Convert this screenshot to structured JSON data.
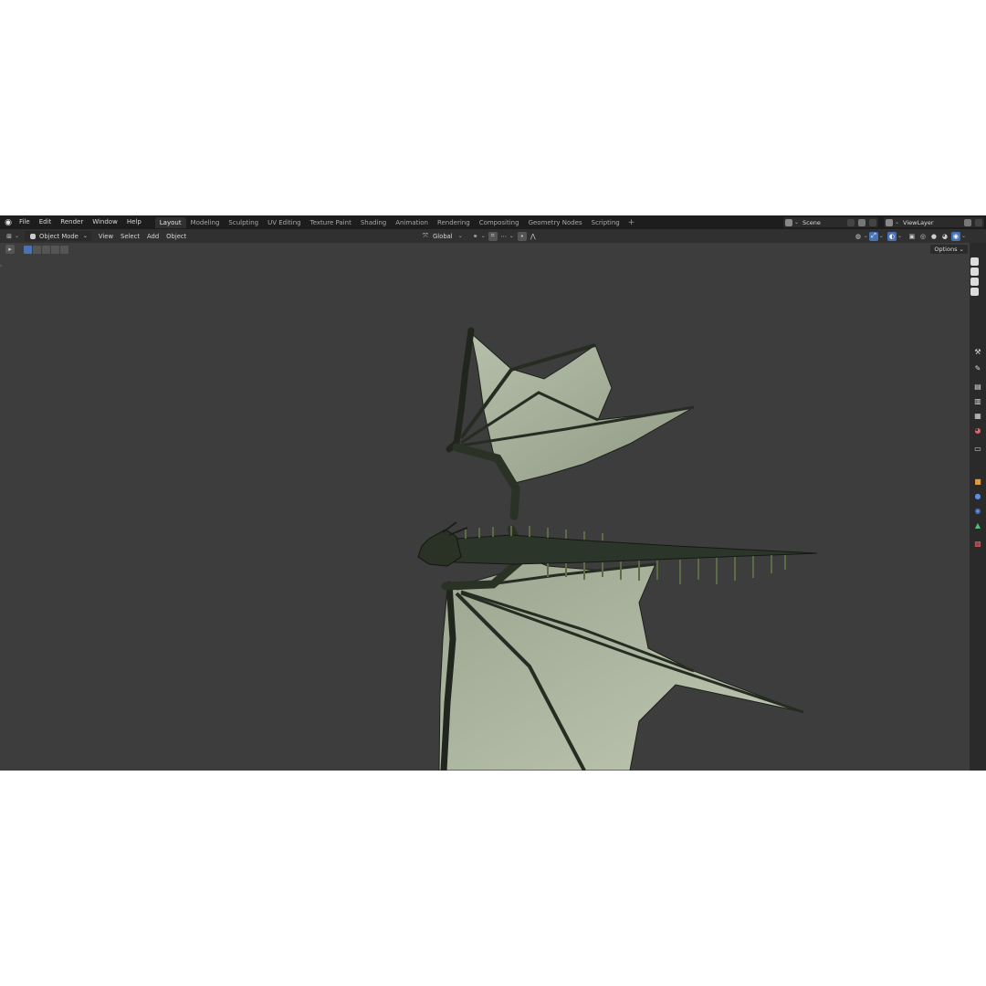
{
  "menu": [
    "File",
    "Edit",
    "Render",
    "Window",
    "Help"
  ],
  "workspaces": [
    {
      "label": "Layout",
      "active": true
    },
    {
      "label": "Modeling"
    },
    {
      "label": "Sculpting"
    },
    {
      "label": "UV Editing"
    },
    {
      "label": "Texture Paint"
    },
    {
      "label": "Shading"
    },
    {
      "label": "Animation"
    },
    {
      "label": "Rendering"
    },
    {
      "label": "Compositing"
    },
    {
      "label": "Geometry Nodes"
    },
    {
      "label": "Scripting"
    }
  ],
  "scene": {
    "name": "Scene",
    "view_layer": "ViewLayer"
  },
  "header": {
    "mode": "Object Mode",
    "menus": [
      "View",
      "Select",
      "Add",
      "Object"
    ],
    "transform_orientation": "Global"
  },
  "toolbar": {
    "options_label": "Options"
  },
  "colors": {
    "accent": "#4772b3",
    "viewport_bg": "#3d3d3d",
    "header_bg": "#303030",
    "topbar_bg": "#1d1d1d",
    "wing_membrane": "#a8b29c",
    "dragon_body": "#2a3328"
  }
}
